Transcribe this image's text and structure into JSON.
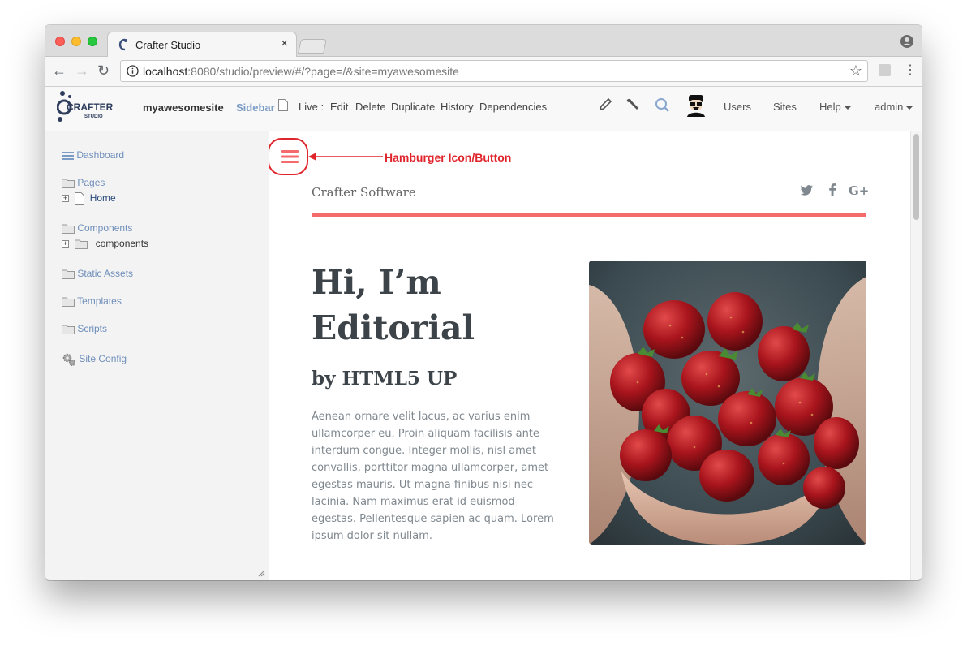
{
  "browser": {
    "tab_title": "Crafter Studio",
    "tab_close": "×",
    "url_host": "localhost",
    "url_rest": ":8080/studio/preview/#/?page=/&site=myawesomesite",
    "icons": [
      "back-arrow-icon",
      "forward-arrow-icon",
      "reload-icon",
      "info-icon",
      "star-icon",
      "profile-icon",
      "menu-dots-icon"
    ]
  },
  "header": {
    "site_name": "myawesomesite",
    "sidebar_label": "Sidebar",
    "live_label": "Live :",
    "actions": [
      "Edit",
      "Delete",
      "Duplicate",
      "History",
      "Dependencies"
    ],
    "users": "Users",
    "sites": "Sites",
    "help": "Help",
    "admin": "admin",
    "tool_icons": [
      "pencil-icon",
      "wrench-icon",
      "search-icon",
      "avatar-icon"
    ]
  },
  "sidebar": {
    "dashboard": "Dashboard",
    "pages": "Pages",
    "home": "Home",
    "components": "Components",
    "components_child": "components",
    "static_assets": "Static Assets",
    "templates": "Templates",
    "scripts": "Scripts",
    "site_config": "Site Config"
  },
  "preview": {
    "annotation": "Hamburger Icon/Button",
    "brand": "Crafter Software",
    "title": "Hi, I’m Editorial",
    "subtitle": "by HTML5 UP",
    "body": "Aenean ornare velit lacus, ac varius enim ullamcorper eu. Proin aliquam facilisis ante interdum congue. Integer mollis, nisl amet convallis, porttitor magna ullamcorper, amet egestas mauris. Ut magna finibus nisi nec lacinia. Nam maximus erat id euismod egestas. Pellentesque sapien ac quam. Lorem ipsum dolor sit nullam.",
    "image_subject": "strawberries-in-hands",
    "social_icons": [
      "twitter-icon",
      "facebook-icon",
      "google-plus-icon"
    ],
    "social_labels": [
      "G+"
    ]
  },
  "colors": {
    "accent": "#f56a6a",
    "annotation": "#e0242b",
    "sidebar_link": "#6f8fbb"
  }
}
